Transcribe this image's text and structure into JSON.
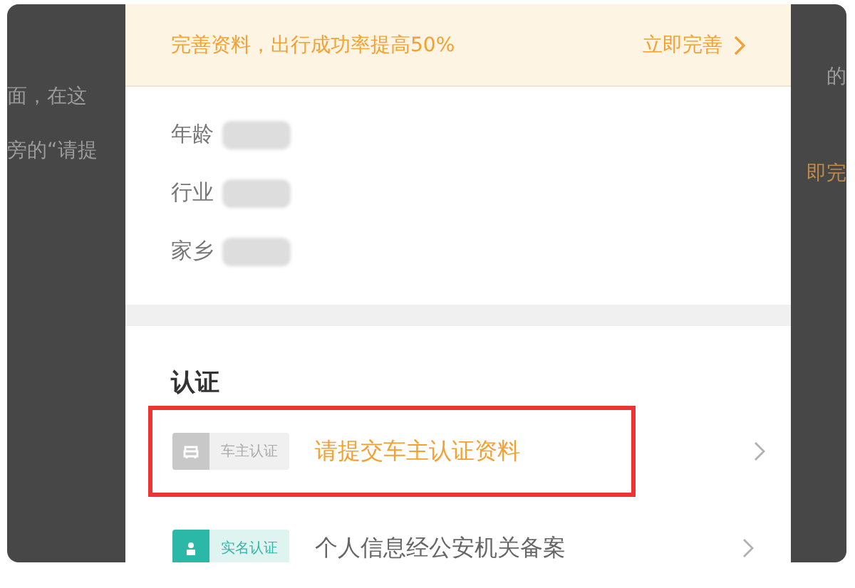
{
  "background_text": {
    "left": [
      "面，在这",
      "旁的“请提"
    ],
    "right": [
      "的",
      "即完"
    ]
  },
  "banner": {
    "message": "完善资料，出行成功率提高50%",
    "action": "立即完善"
  },
  "profile_fields": [
    {
      "label": "年龄"
    },
    {
      "label": "行业"
    },
    {
      "label": "家乡"
    }
  ],
  "verification": {
    "title": "认证",
    "items": [
      {
        "badge": "车主认证",
        "text": "请提交车主认证资料",
        "verified": false,
        "highlighted": true
      },
      {
        "badge": "实名认证",
        "text": "个人信息经公安机关备案",
        "verified": true,
        "highlighted": false
      }
    ]
  }
}
